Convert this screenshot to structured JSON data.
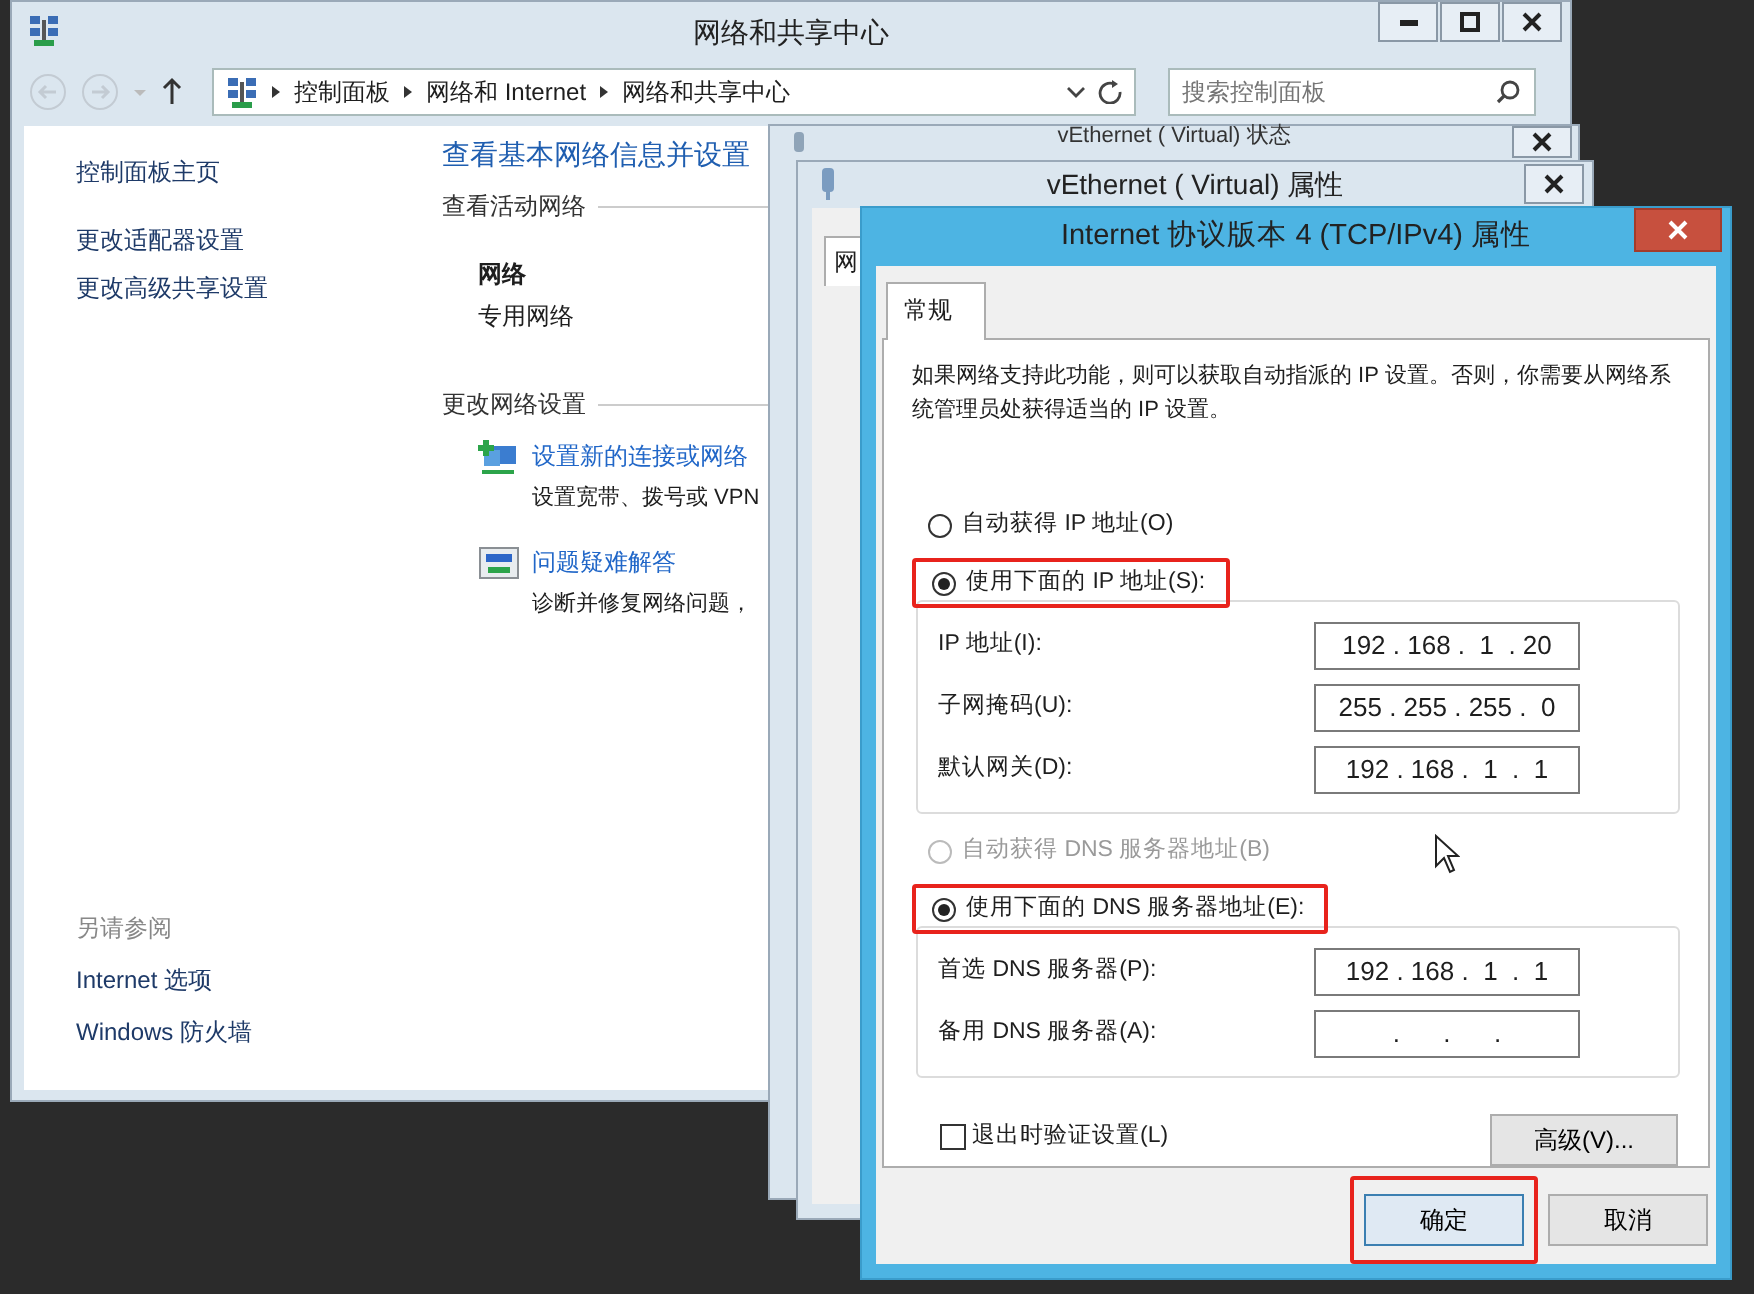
{
  "main_window": {
    "title": "网络和共享中心",
    "address": {
      "path": [
        "控制面板",
        "网络和 Internet",
        "网络和共享中心"
      ]
    },
    "search": {
      "placeholder": "搜索控制面板"
    },
    "sidebar": {
      "links": [
        "控制面板主页",
        "更改适配器设置",
        "更改高级共享设置"
      ],
      "see_also_heading": "另请参阅",
      "see_also": [
        "Internet 选项",
        "Windows 防火墙"
      ]
    },
    "content": {
      "heading": "查看基本网络信息并设置",
      "active_heading": "查看活动网络",
      "network_name": "网络",
      "network_type": "专用网络",
      "change_heading": "更改网络设置",
      "tasks": [
        {
          "kind": "new-connection",
          "title": "设置新的连接或网络",
          "desc": "设置宽带、拨号或 VPN"
        },
        {
          "kind": "troubleshoot",
          "title": "问题疑难解答",
          "desc": "诊断并修复网络问题，"
        }
      ]
    }
  },
  "status_window": {
    "title": "vEthernet ( Virtual) 状态"
  },
  "properties_window": {
    "title": "vEthernet ( Virtual) 属性",
    "tab": "网"
  },
  "ipv4_dialog": {
    "title": "Internet 协议版本 4 (TCP/IPv4) 属性",
    "tabs": [
      {
        "label": "常规",
        "selected": true
      }
    ],
    "description": "如果网络支持此功能，则可以获取自动指派的 IP 设置。否则，你需要从网络系统管理员处获得适当的 IP 设置。",
    "ip_options": [
      {
        "label": "自动获得 IP 地址(O)",
        "selected": false,
        "disabled": false,
        "highlighted": false
      },
      {
        "label": "使用下面的 IP 地址(S):",
        "selected": true,
        "disabled": false,
        "highlighted": true
      }
    ],
    "ip_fields": [
      {
        "label": "IP 地址(I):",
        "value": "192 . 168 .  1  . 20"
      },
      {
        "label": "子网掩码(U):",
        "value": "255 . 255 . 255 .  0"
      },
      {
        "label": "默认网关(D):",
        "value": "192 . 168 .  1  .  1"
      }
    ],
    "dns_options": [
      {
        "label": "自动获得 DNS 服务器地址(B)",
        "selected": false,
        "disabled": true,
        "highlighted": false
      },
      {
        "label": "使用下面的 DNS 服务器地址(E):",
        "selected": true,
        "disabled": false,
        "highlighted": true
      }
    ],
    "dns_fields": [
      {
        "label": "首选 DNS 服务器(P):",
        "value": "192 . 168 .  1  .  1"
      },
      {
        "label": "备用 DNS 服务器(A):",
        "value": "     .      .      .     "
      }
    ],
    "validate": {
      "label": "退出时验证设置(L)",
      "checked": false
    },
    "advanced_button": "高级(V)...",
    "buttons": [
      {
        "label": "确定",
        "highlighted": true
      },
      {
        "label": "取消",
        "highlighted": false
      }
    ]
  }
}
